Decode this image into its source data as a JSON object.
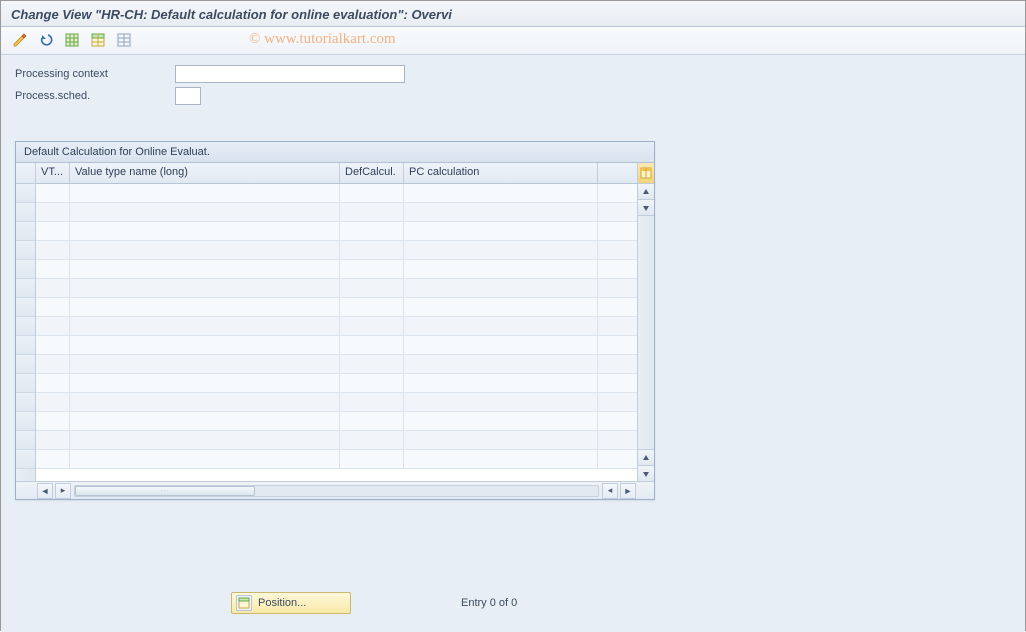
{
  "window": {
    "title": "Change View \"HR-CH: Default calculation for online evaluation\": Overvi"
  },
  "watermark": "© www.tutorialkart.com",
  "toolbar": {
    "icons": [
      "pencil-icon",
      "undo-icon",
      "select-all-green-icon",
      "select-block-icon",
      "deselect-icon"
    ]
  },
  "form": {
    "processing_context_label": "Processing context",
    "processing_context_value": "",
    "process_sched_label": "Process.sched.",
    "process_sched_value": ""
  },
  "grid": {
    "title": "Default Calculation for Online Evaluat.",
    "columns": {
      "vt": "VT...",
      "name": "Value type name (long)",
      "def": "DefCalcul.",
      "pc": "PC calculation"
    },
    "row_count_visible": 15
  },
  "footer": {
    "position_button": "Position...",
    "entry_text": "Entry 0 of 0"
  }
}
